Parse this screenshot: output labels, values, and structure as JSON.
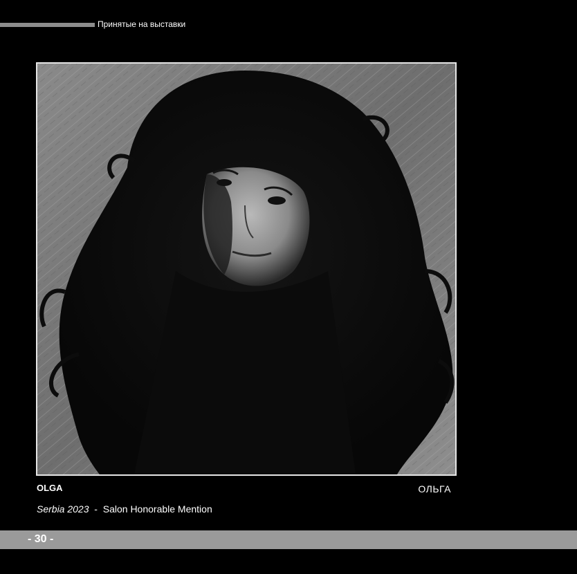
{
  "header": {
    "section_title": "Принятые на выставки"
  },
  "photo": {
    "description_icon": "portrait-photo"
  },
  "caption": {
    "title_latin": "OLGA",
    "title_cyrillic": "ОЛЬГА",
    "country_year": "Serbia 2023",
    "separator": "  -  ",
    "award": "Salon Honorable Mention"
  },
  "footer": {
    "page_number": "- 30 -"
  },
  "colors": {
    "background": "#000000",
    "header_rule": "#8c8c8c",
    "footer_bar": "#9a9a9a",
    "frame_border": "#e6e6e6"
  }
}
